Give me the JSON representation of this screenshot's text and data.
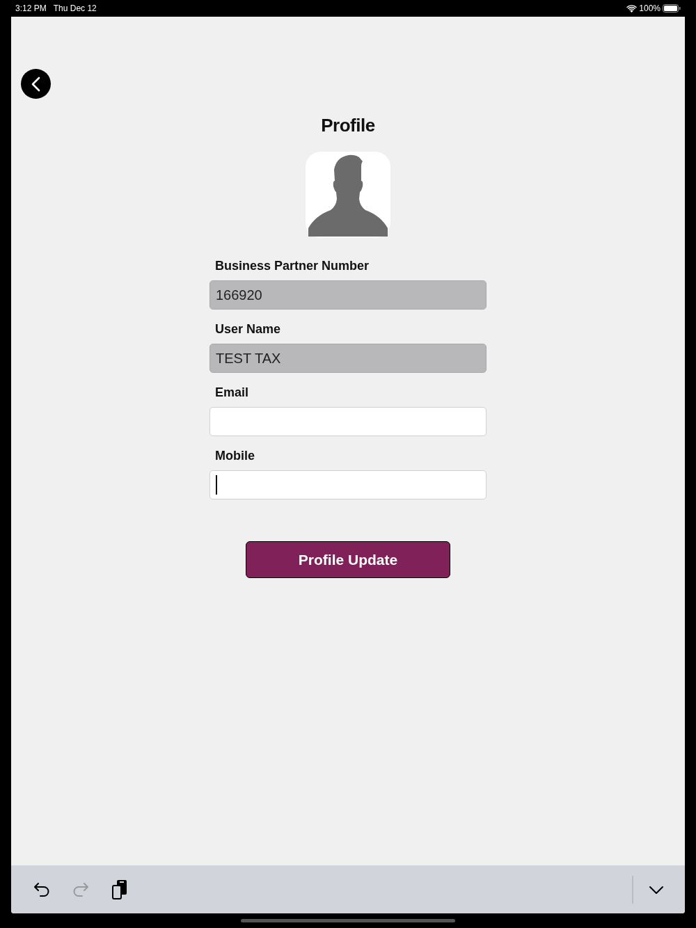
{
  "status_bar": {
    "time": "3:12 PM",
    "date": "Thu Dec 12",
    "battery": "100%"
  },
  "title": "Profile",
  "fields": [
    {
      "label": "Business Partner Number",
      "value": "166920",
      "disabled": true,
      "focused": false
    },
    {
      "label": "User Name",
      "value": "TEST TAX",
      "disabled": true,
      "focused": false
    },
    {
      "label": "Email",
      "disabled": false,
      "focused": false
    },
    {
      "label": "Mobile",
      "disabled": false,
      "focused": true
    }
  ],
  "update_button": "Profile Update",
  "keyboard_toolbar": [
    {
      "kind": "undo",
      "disabled": false
    },
    {
      "kind": "redo",
      "disabled": true
    },
    {
      "kind": "paste",
      "disabled": false
    }
  ]
}
